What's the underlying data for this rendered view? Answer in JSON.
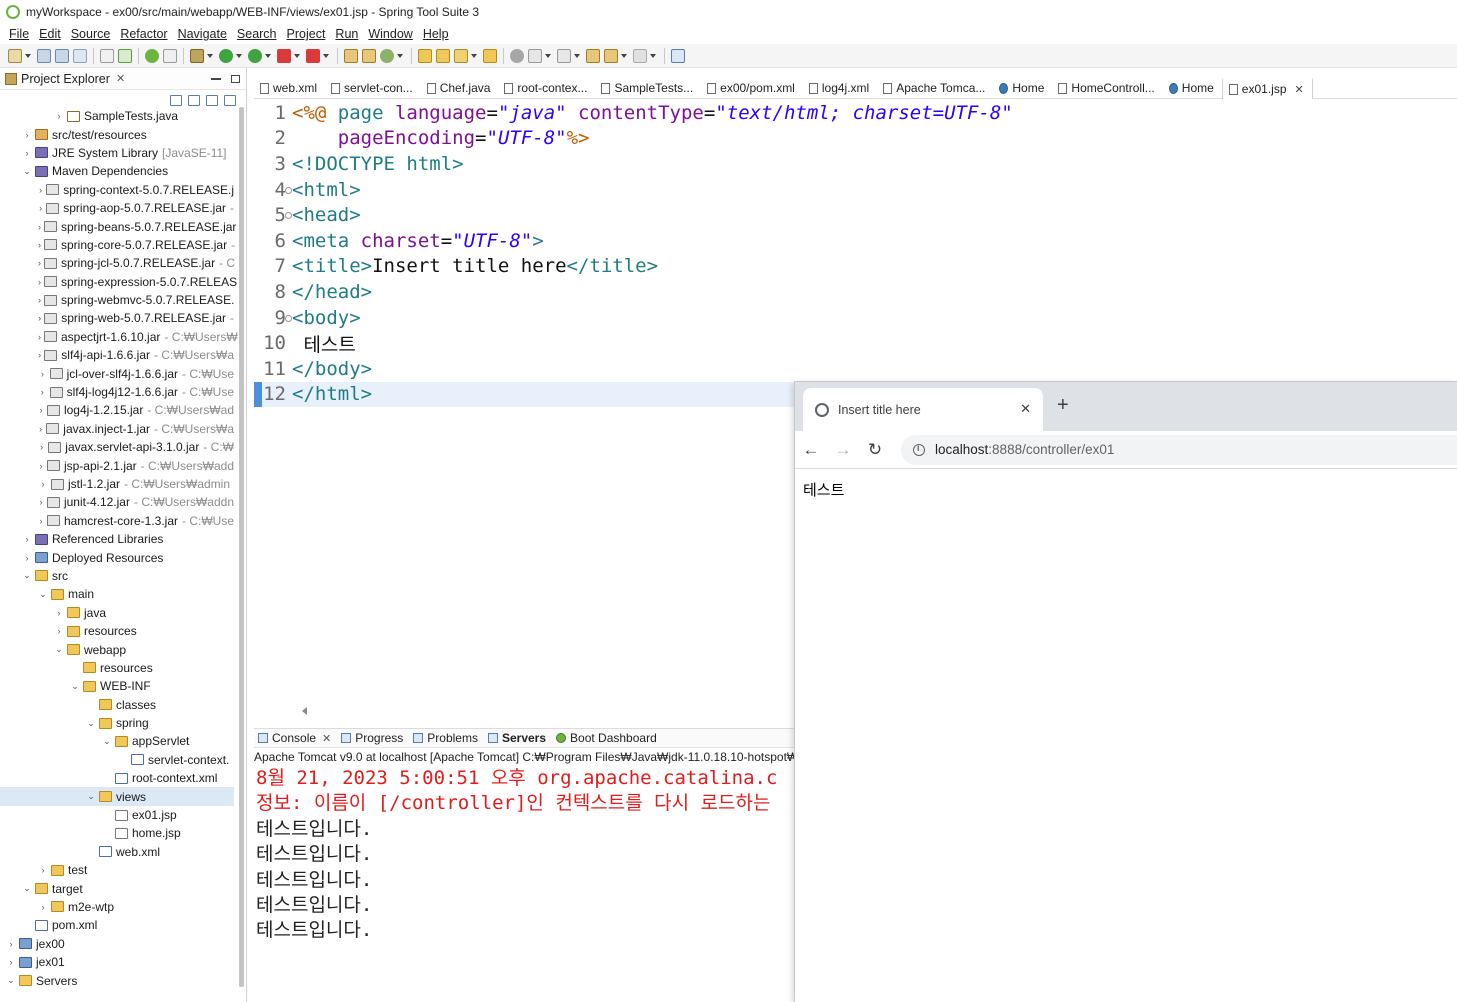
{
  "window": {
    "title": "myWorkspace - ex00/src/main/webapp/WEB-INF/views/ex01.jsp - Spring Tool Suite 3"
  },
  "menu": [
    "File",
    "Edit",
    "Source",
    "Refactor",
    "Navigate",
    "Search",
    "Project",
    "Run",
    "Window",
    "Help"
  ],
  "explorer": {
    "title": "Project Explorer",
    "tree": [
      {
        "label": "SampleTests.java",
        "depth": 3,
        "twisty": ">",
        "icon": "java"
      },
      {
        "label": "src/test/resources",
        "depth": 1,
        "twisty": ">",
        "icon": "pkg"
      },
      {
        "label": "JRE System Library",
        "suffix": "[JavaSE-11]",
        "depth": 1,
        "twisty": ">",
        "icon": "lib"
      },
      {
        "label": "Maven Dependencies",
        "depth": 1,
        "twisty": "v",
        "icon": "lib"
      },
      {
        "label": "spring-context-5.0.7.RELEASE.j",
        "depth": 2,
        "twisty": ">",
        "icon": "jar"
      },
      {
        "label": "spring-aop-5.0.7.RELEASE.jar",
        "suffix": "-",
        "depth": 2,
        "twisty": ">",
        "icon": "jar"
      },
      {
        "label": "spring-beans-5.0.7.RELEASE.jar",
        "depth": 2,
        "twisty": ">",
        "icon": "jar"
      },
      {
        "label": "spring-core-5.0.7.RELEASE.jar",
        "suffix": "-",
        "depth": 2,
        "twisty": ">",
        "icon": "jar"
      },
      {
        "label": "spring-jcl-5.0.7.RELEASE.jar",
        "suffix": "- C",
        "depth": 2,
        "twisty": ">",
        "icon": "jar"
      },
      {
        "label": "spring-expression-5.0.7.RELEAS",
        "depth": 2,
        "twisty": ">",
        "icon": "jar"
      },
      {
        "label": "spring-webmvc-5.0.7.RELEASE.",
        "depth": 2,
        "twisty": ">",
        "icon": "jar"
      },
      {
        "label": "spring-web-5.0.7.RELEASE.jar",
        "suffix": "-",
        "depth": 2,
        "twisty": ">",
        "icon": "jar"
      },
      {
        "label": "aspectjrt-1.6.10.jar",
        "suffix": "- C:₩Users₩",
        "depth": 2,
        "twisty": ">",
        "icon": "jar"
      },
      {
        "label": "slf4j-api-1.6.6.jar",
        "suffix": "- C:₩Users₩a",
        "depth": 2,
        "twisty": ">",
        "icon": "jar"
      },
      {
        "label": "jcl-over-slf4j-1.6.6.jar",
        "suffix": "- C:₩Use",
        "depth": 2,
        "twisty": ">",
        "icon": "jar"
      },
      {
        "label": "slf4j-log4j12-1.6.6.jar",
        "suffix": "- C:₩Use",
        "depth": 2,
        "twisty": ">",
        "icon": "jar"
      },
      {
        "label": "log4j-1.2.15.jar",
        "suffix": "- C:₩Users₩ad",
        "depth": 2,
        "twisty": ">",
        "icon": "jar"
      },
      {
        "label": "javax.inject-1.jar",
        "suffix": "- C:₩Users₩a",
        "depth": 2,
        "twisty": ">",
        "icon": "jar"
      },
      {
        "label": "javax.servlet-api-3.1.0.jar",
        "suffix": "- C:₩",
        "depth": 2,
        "twisty": ">",
        "icon": "jar"
      },
      {
        "label": "jsp-api-2.1.jar",
        "suffix": "- C:₩Users₩add",
        "depth": 2,
        "twisty": ">",
        "icon": "jar"
      },
      {
        "label": "jstl-1.2.jar",
        "suffix": "- C:₩Users₩admin",
        "depth": 2,
        "twisty": ">",
        "icon": "jar"
      },
      {
        "label": "junit-4.12.jar",
        "suffix": "- C:₩Users₩addn",
        "depth": 2,
        "twisty": ">",
        "icon": "jar"
      },
      {
        "label": "hamcrest-core-1.3.jar",
        "suffix": "- C:₩Use",
        "depth": 2,
        "twisty": ">",
        "icon": "jar"
      },
      {
        "label": "Referenced Libraries",
        "depth": 1,
        "twisty": ">",
        "icon": "lib"
      },
      {
        "label": "Deployed Resources",
        "depth": 1,
        "twisty": ">",
        "icon": "proj"
      },
      {
        "label": "src",
        "depth": 1,
        "twisty": "v",
        "icon": "folder"
      },
      {
        "label": "main",
        "depth": 2,
        "twisty": "v",
        "icon": "folder"
      },
      {
        "label": "java",
        "depth": 3,
        "twisty": ">",
        "icon": "folder"
      },
      {
        "label": "resources",
        "depth": 3,
        "twisty": ">",
        "icon": "folder"
      },
      {
        "label": "webapp",
        "depth": 3,
        "twisty": "v",
        "icon": "folder"
      },
      {
        "label": "resources",
        "depth": 4,
        "twisty": "",
        "icon": "folder"
      },
      {
        "label": "WEB-INF",
        "depth": 4,
        "twisty": "v",
        "icon": "folder"
      },
      {
        "label": "classes",
        "depth": 5,
        "twisty": "",
        "icon": "folder"
      },
      {
        "label": "spring",
        "depth": 5,
        "twisty": "v",
        "icon": "folder"
      },
      {
        "label": "appServlet",
        "depth": 6,
        "twisty": "v",
        "icon": "folder"
      },
      {
        "label": "servlet-context.",
        "depth": 7,
        "twisty": "",
        "icon": "xml"
      },
      {
        "label": "root-context.xml",
        "depth": 6,
        "twisty": "",
        "icon": "xml"
      },
      {
        "label": "views",
        "depth": 5,
        "twisty": "v",
        "icon": "folder",
        "selected": true
      },
      {
        "label": "ex01.jsp",
        "depth": 6,
        "twisty": "",
        "icon": "jsp"
      },
      {
        "label": "home.jsp",
        "depth": 6,
        "twisty": "",
        "icon": "jsp"
      },
      {
        "label": "web.xml",
        "depth": 5,
        "twisty": "",
        "icon": "xml"
      },
      {
        "label": "test",
        "depth": 2,
        "twisty": ">",
        "icon": "folder"
      },
      {
        "label": "target",
        "depth": 1,
        "twisty": "v",
        "icon": "folder"
      },
      {
        "label": "m2e-wtp",
        "depth": 2,
        "twisty": ">",
        "icon": "folder"
      },
      {
        "label": "pom.xml",
        "depth": 1,
        "twisty": "",
        "icon": "xml"
      },
      {
        "label": "jex00",
        "depth": 0,
        "twisty": ">",
        "icon": "proj"
      },
      {
        "label": "jex01",
        "depth": 0,
        "twisty": ">",
        "icon": "proj"
      },
      {
        "label": "Servers",
        "depth": 0,
        "twisty": "v",
        "icon": "folder"
      }
    ]
  },
  "editor_tabs": [
    {
      "label": "web.xml",
      "icon": "file"
    },
    {
      "label": "servlet-con...",
      "icon": "file"
    },
    {
      "label": "Chef.java",
      "icon": "file"
    },
    {
      "label": "root-contex...",
      "icon": "file"
    },
    {
      "label": "SampleTests...",
      "icon": "file"
    },
    {
      "label": "ex00/pom.xml",
      "icon": "file"
    },
    {
      "label": "log4j.xml",
      "icon": "file"
    },
    {
      "label": "Apache Tomca...",
      "icon": "file"
    },
    {
      "label": "Home",
      "icon": "globe"
    },
    {
      "label": "HomeControll...",
      "icon": "file"
    },
    {
      "label": "Home",
      "icon": "globe"
    },
    {
      "label": "ex01.jsp",
      "icon": "file",
      "active": true
    }
  ],
  "code": [
    {
      "n": "1",
      "fold": false,
      "segs": [
        [
          "dir",
          "<%@ "
        ],
        [
          "tag",
          "page "
        ],
        [
          "attr",
          "language"
        ],
        [
          "txt",
          "="
        ],
        [
          "val",
          "\"java\""
        ],
        [
          "txt",
          " "
        ],
        [
          "attr",
          "contentType"
        ],
        [
          "txt",
          "="
        ],
        [
          "val",
          "\"text/html; charset=UTF-8\""
        ]
      ]
    },
    {
      "n": "2",
      "fold": false,
      "segs": [
        [
          "txt",
          "    "
        ],
        [
          "attr",
          "pageEncoding"
        ],
        [
          "txt",
          "="
        ],
        [
          "val",
          "\"UTF-8\""
        ],
        [
          "dir",
          "%>"
        ]
      ]
    },
    {
      "n": "3",
      "fold": false,
      "segs": [
        [
          "tag",
          "<!DOCTYPE html>"
        ]
      ]
    },
    {
      "n": "4",
      "fold": true,
      "segs": [
        [
          "tag",
          "<html>"
        ]
      ]
    },
    {
      "n": "5",
      "fold": true,
      "segs": [
        [
          "tag",
          "<head>"
        ]
      ]
    },
    {
      "n": "6",
      "fold": false,
      "segs": [
        [
          "tag",
          "<meta "
        ],
        [
          "attr",
          "charset"
        ],
        [
          "txt",
          "="
        ],
        [
          "val",
          "\"UTF-8\""
        ],
        [
          "tag",
          ">"
        ]
      ]
    },
    {
      "n": "7",
      "fold": false,
      "segs": [
        [
          "tag",
          "<title>"
        ],
        [
          "txt",
          "Insert title here"
        ],
        [
          "tag",
          "</title>"
        ]
      ]
    },
    {
      "n": "8",
      "fold": false,
      "segs": [
        [
          "tag",
          "</head>"
        ]
      ]
    },
    {
      "n": "9",
      "fold": true,
      "segs": [
        [
          "tag",
          "<body>"
        ]
      ]
    },
    {
      "n": "10",
      "fold": false,
      "segs": [
        [
          "txt",
          " 테스트"
        ]
      ]
    },
    {
      "n": "11",
      "fold": false,
      "segs": [
        [
          "tag",
          "</body>"
        ]
      ]
    },
    {
      "n": "12",
      "fold": false,
      "current": true,
      "segs": [
        [
          "tag",
          "</html>"
        ]
      ]
    }
  ],
  "console_tabs": [
    {
      "label": "Console",
      "icon": "console",
      "close": true
    },
    {
      "label": "Progress",
      "icon": "progress"
    },
    {
      "label": "Problems",
      "icon": "problems"
    },
    {
      "label": "Servers",
      "icon": "servers",
      "bold": true
    },
    {
      "label": "Boot Dashboard",
      "icon": "boot"
    }
  ],
  "console": {
    "header": "Apache Tomcat v9.0  at localhost [Apache Tomcat] C:₩Program Files₩Java₩jdk-11.0.18.10-hotspot₩",
    "lines": [
      {
        "text": "8월 21, 2023 5:00:51 오후 org.apache.catalina.c",
        "color": "red"
      },
      {
        "text": "정보: 이름이 [/controller]인 컨텍스트를 다시 로드하는",
        "color": "red"
      },
      {
        "text": "테스트입니다.",
        "color": "black"
      },
      {
        "text": "테스트입니다.",
        "color": "black"
      },
      {
        "text": "테스트입니다.",
        "color": "black"
      },
      {
        "text": "테스트입니다.",
        "color": "black"
      },
      {
        "text": "테스트입니다.",
        "color": "black"
      }
    ]
  },
  "browser": {
    "tab_title": "Insert title here",
    "url_host": "localhost",
    "url_path": ":8888/controller/ex01",
    "page_text": "테스트"
  },
  "colors": {
    "accent": "#4e8fdc",
    "console_error": "#e21c1c",
    "tag": "#1f7c84",
    "attr": "#7f0f9a",
    "value": "#2a00ff"
  }
}
